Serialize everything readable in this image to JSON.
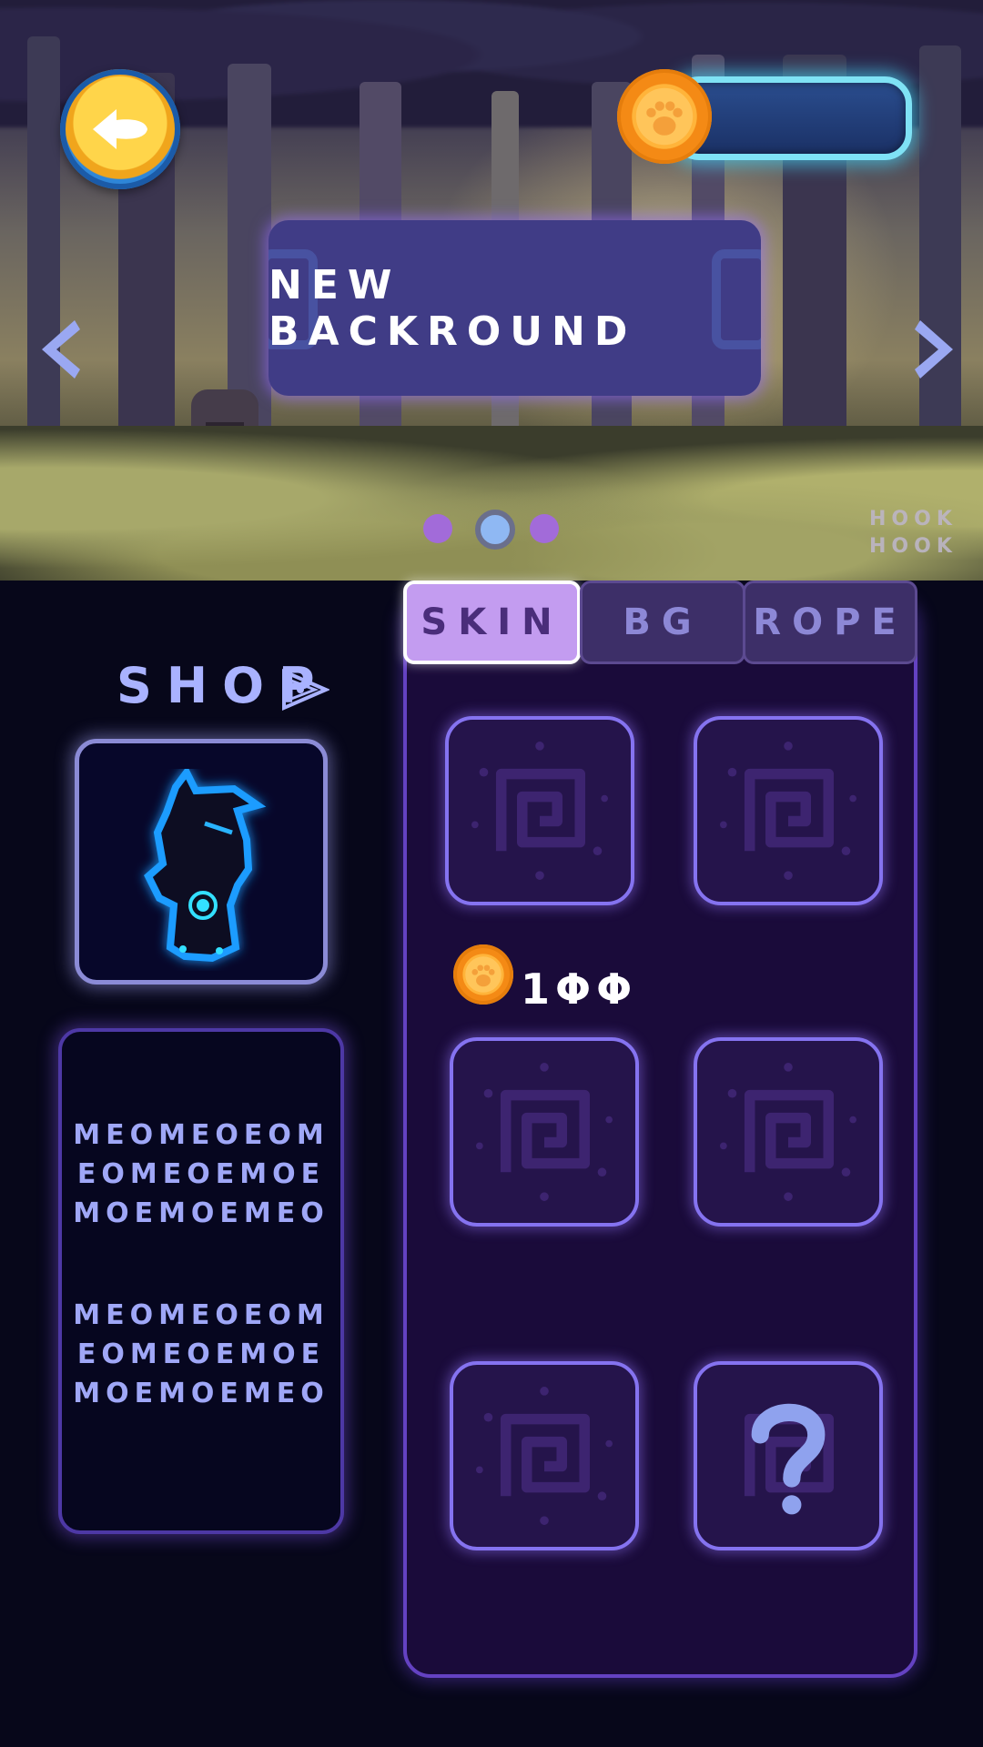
{
  "banner": {
    "title": "NEW BACKROUND",
    "watermark_line1": "HOOK",
    "watermark_line2": "HOOK",
    "carousel": {
      "count": 3,
      "active_index": 1
    }
  },
  "header": {
    "back_icon": "back-arrow-icon",
    "coin_icon": "paw-coin-icon",
    "coin_balance": ""
  },
  "shop": {
    "title": "SHOP",
    "icon": "pyramid-eye-icon",
    "description_1": "MEOMEOEOM\nEOMEOEMOE\nMOEMOEMEO",
    "description_2": "MEOMEOEOM\nEOMEOEMOE\nMOEMOEMEO"
  },
  "tabs": [
    {
      "label": "SKIN",
      "active": true
    },
    {
      "label": "BG",
      "active": false
    },
    {
      "label": "ROPE",
      "active": false
    }
  ],
  "items": {
    "price_icon": "paw-coin-icon",
    "price": "1ΦΦ",
    "slots": [
      {
        "kind": "spiral",
        "icon": "spiral-icon"
      },
      {
        "kind": "spiral",
        "icon": "spiral-icon"
      },
      {
        "kind": "spiral",
        "icon": "spiral-icon"
      },
      {
        "kind": "spiral",
        "icon": "spiral-icon"
      },
      {
        "kind": "spiral",
        "icon": "spiral-icon"
      },
      {
        "kind": "locked",
        "icon": "question-mark-icon"
      }
    ]
  },
  "colors": {
    "background": "#07071a",
    "accent_purple": "#8573f0",
    "tab_active": "#c39cf0",
    "glow_cyan": "#7fe2f5",
    "coin_orange": "#f48a15"
  }
}
